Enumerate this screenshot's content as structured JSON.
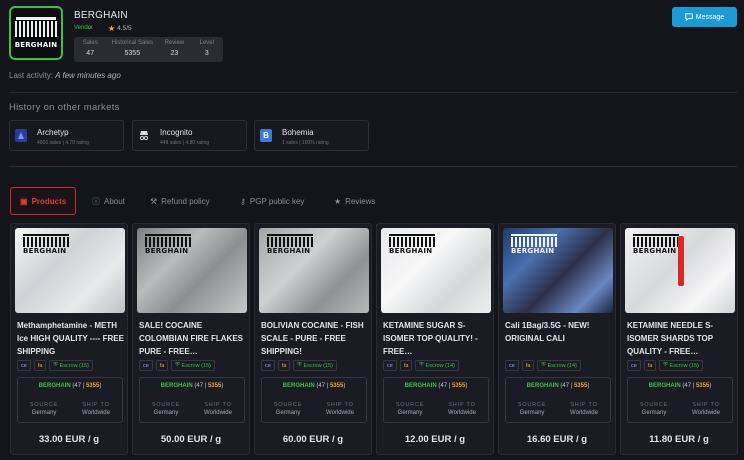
{
  "vendor": {
    "logo_text": "BERGHAIN",
    "name": "BERGHAIN",
    "role": "Vendor",
    "rating": "4.5/5",
    "stats": [
      {
        "label": "Sales",
        "value": "47"
      },
      {
        "label": "Historical Sales",
        "value": "5355"
      },
      {
        "label": "Review",
        "value": "23"
      },
      {
        "label": "Level",
        "value": "3"
      }
    ],
    "last_activity_label": "Last activity:",
    "last_activity_value": "A few minutes ago"
  },
  "message_button": {
    "label": "Message",
    "icon": "chat-icon"
  },
  "markets_section": {
    "title": "History on other markets",
    "markets": [
      {
        "name": "Archetyp",
        "sub": "4906 sales  |  4.70 rating",
        "icon": "archetyp-icon",
        "color": "#3b55c7"
      },
      {
        "name": "Incognito",
        "sub": "448 sales  |  4.80 rating",
        "icon": "incognito-icon",
        "color": "#d9dae0"
      },
      {
        "name": "Bohemia",
        "sub": "1 sales  |  100% rating",
        "icon": "bohemia-icon",
        "color": "#3e7bd6"
      }
    ]
  },
  "tabs": [
    {
      "label": "Products",
      "icon": "box-icon"
    },
    {
      "label": "About",
      "icon": "info-icon"
    },
    {
      "label": "Refund policy",
      "icon": "hammer-icon"
    },
    {
      "label": "PGP public key",
      "icon": "key-icon"
    },
    {
      "label": "Reviews",
      "icon": "star-icon"
    }
  ],
  "product_labels": {
    "seller": "BERGHAIN",
    "seller_sales": "47",
    "seller_hist": "5355",
    "source_label": "SOURCE",
    "ship_label": "SHIP TO",
    "source": "Germany",
    "ship_to": "Worldwide",
    "badge1": "ce",
    "badge2": "fa"
  },
  "products": [
    {
      "title": "Methamphetamine - METH Ice HIGH QUALITY ---- FREE SHIPPING",
      "escrow": "Escrow (15)",
      "price": "33.00 EUR / g"
    },
    {
      "title": "SALE! COCAINE COLOMBIAN FIRE FLAKES PURE - FREE…",
      "escrow": "Escrow (15)",
      "price": "50.00 EUR / g"
    },
    {
      "title": "BOLIVIAN COCAINE - FISH SCALE - PURE - FREE SHIPPING!",
      "escrow": "Escrow (15)",
      "price": "60.00 EUR / g"
    },
    {
      "title": "KETAMINE SUGAR S-ISOMER TOP QUALITY! - FREE…",
      "escrow": "Escrow (14)",
      "price": "12.00 EUR / g"
    },
    {
      "title": "Cali 1Bag/3.5G - NEW! ORIGINAL CALI",
      "escrow": "Escrow (14)",
      "price": "16.60 EUR / g"
    },
    {
      "title": "KETAMINE NEEDLE S-ISOMER SHARDS TOP QUALITY - FREE…",
      "escrow": "Escrow (15)",
      "price": "11.80 EUR / g"
    }
  ],
  "colors": {
    "accent": "#1b9ad6",
    "vendor_green": "#3fbf4a",
    "active_tab": "#e23a3a",
    "star": "#f3b51b"
  }
}
